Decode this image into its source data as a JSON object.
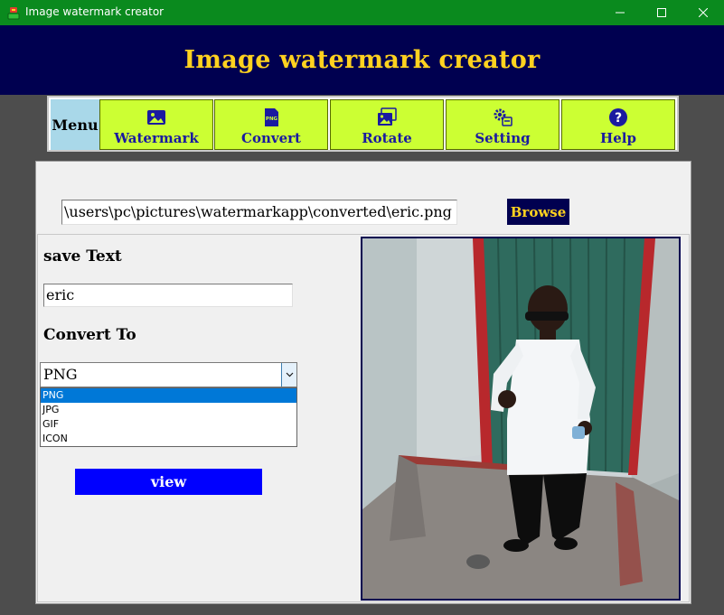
{
  "window": {
    "title": "Image watermark creator",
    "controls": {
      "minimize": "—",
      "maximize": "☐",
      "close": "✕"
    }
  },
  "header": {
    "title": "Image watermark creator"
  },
  "menu": {
    "label": "Menu",
    "items": [
      {
        "label": "Watermark",
        "icon": "image-icon"
      },
      {
        "label": "Convert",
        "icon": "png-file-icon"
      },
      {
        "label": "Rotate",
        "icon": "gallery-icon"
      },
      {
        "label": "Setting",
        "icon": "gear-icon"
      },
      {
        "label": "Help",
        "icon": "help-icon"
      }
    ]
  },
  "main": {
    "path_value": "\\users\\pc\\pictures\\watermarkapp\\converted\\eric.png",
    "browse_label": "Browse",
    "save_text_label": "save Text",
    "save_text_value": "eric",
    "convert_to_label": "Convert To",
    "format_selected": "PNG",
    "format_options": [
      "PNG",
      "JPG",
      "GIF",
      "ICON"
    ],
    "view_label": "view"
  },
  "colors": {
    "titlebar": "#0a8a1e",
    "header_bg": "#000050",
    "header_text": "#ffd21f",
    "menu_item_bg": "#ccff33",
    "menu_text": "#1a1aa0",
    "view_button": "#0000ff",
    "selection": "#0078d7"
  }
}
